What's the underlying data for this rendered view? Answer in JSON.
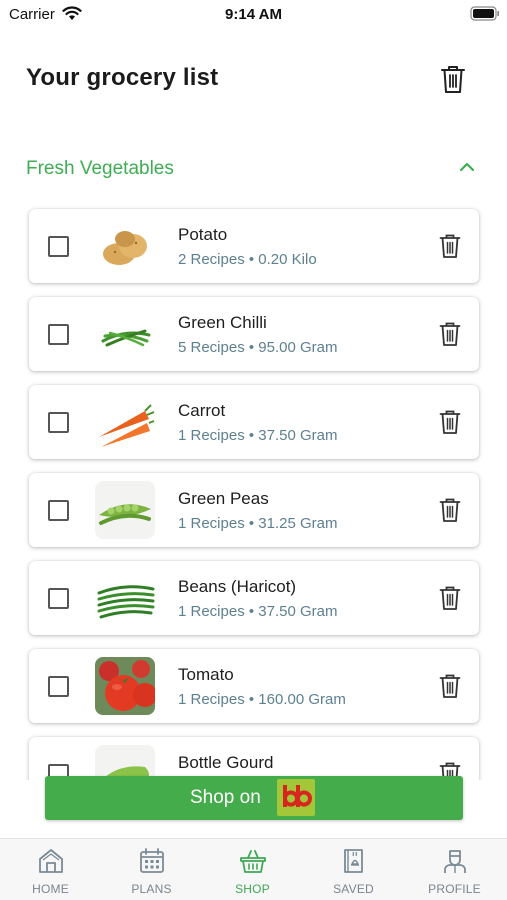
{
  "status_bar": {
    "carrier": "Carrier",
    "time": "9:14 AM"
  },
  "header": {
    "title": "Your grocery list",
    "trash_icon": "trash-icon"
  },
  "section": {
    "title": "Fresh Vegetables",
    "expanded": true,
    "accent_color": "#3fad52"
  },
  "items": [
    {
      "name": "Potato",
      "meta": "2 Recipes • 0.20 Kilo",
      "checked": false,
      "icon": "potato"
    },
    {
      "name": "Green Chilli",
      "meta": "5 Recipes • 95.00 Gram",
      "checked": false,
      "icon": "green-chilli"
    },
    {
      "name": "Carrot",
      "meta": "1 Recipes • 37.50 Gram",
      "checked": false,
      "icon": "carrot"
    },
    {
      "name": "Green Peas",
      "meta": "1 Recipes • 31.25 Gram",
      "checked": false,
      "icon": "green-peas"
    },
    {
      "name": "Beans (Haricot)",
      "meta": "1 Recipes • 37.50 Gram",
      "checked": false,
      "icon": "beans"
    },
    {
      "name": "Tomato",
      "meta": "1 Recipes • 160.00 Gram",
      "checked": false,
      "icon": "tomato"
    },
    {
      "name": "Bottle Gourd",
      "meta": "",
      "checked": false,
      "icon": "bottle-gourd"
    }
  ],
  "shop_button": {
    "label": "Shop on",
    "logo_text": "bb",
    "color": "#44ac4a"
  },
  "tabs": [
    {
      "label": "HOME",
      "icon": "home-icon",
      "active": false
    },
    {
      "label": "PLANS",
      "icon": "calendar-icon",
      "active": false
    },
    {
      "label": "SHOP",
      "icon": "basket-icon",
      "active": true
    },
    {
      "label": "SAVED",
      "icon": "saved-book-icon",
      "active": false
    },
    {
      "label": "PROFILE",
      "icon": "chef-profile-icon",
      "active": false
    }
  ]
}
